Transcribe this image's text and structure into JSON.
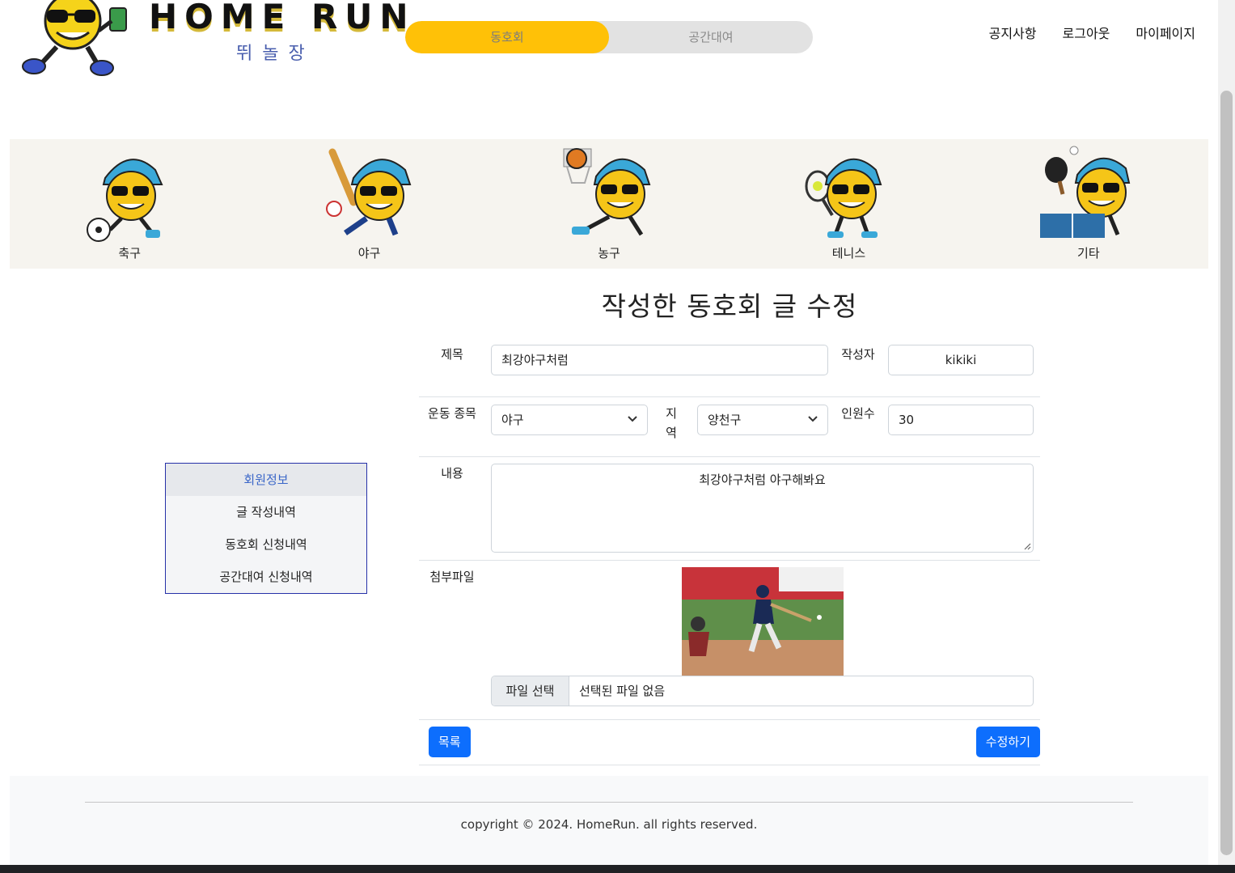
{
  "header": {
    "logo_title": "HOME RUN",
    "logo_subtitle": "뛰놀장",
    "toggle": [
      "동호회",
      "공간대여"
    ],
    "nav": [
      "공지사항",
      "로그아웃",
      "마이페이지"
    ]
  },
  "categories": [
    "축구",
    "야구",
    "농구",
    "테니스",
    "기타"
  ],
  "page_title": "작성한 동호회 글 수정",
  "side_menu": {
    "active": "회원정보",
    "items": [
      "회원정보",
      "글 작성내역",
      "동호회 신청내역",
      "공간대여 신청내역"
    ]
  },
  "form": {
    "title_label": "제목",
    "title_value": "최강야구처럼",
    "author_label": "작성자",
    "author_value": "kikiki",
    "sport_label": "운동 종목",
    "sport_value": "야구",
    "region_label": "지역",
    "region_value": "양천구",
    "count_label": "인원수",
    "count_value": "30",
    "content_label": "내용",
    "content_value": "최강야구처럼 야구해봐요",
    "attach_label": "첨부파일",
    "file_button": "파일 선택",
    "file_status": "선택된 파일 없음"
  },
  "buttons": {
    "list": "목록",
    "submit": "수정하기"
  },
  "footer": {
    "copyright": "copyright © 2024. HomeRun. all rights reserved."
  },
  "colors": {
    "accent_yellow": "#ffc107",
    "primary_blue": "#0d6efd",
    "side_border": "#2631a8"
  }
}
